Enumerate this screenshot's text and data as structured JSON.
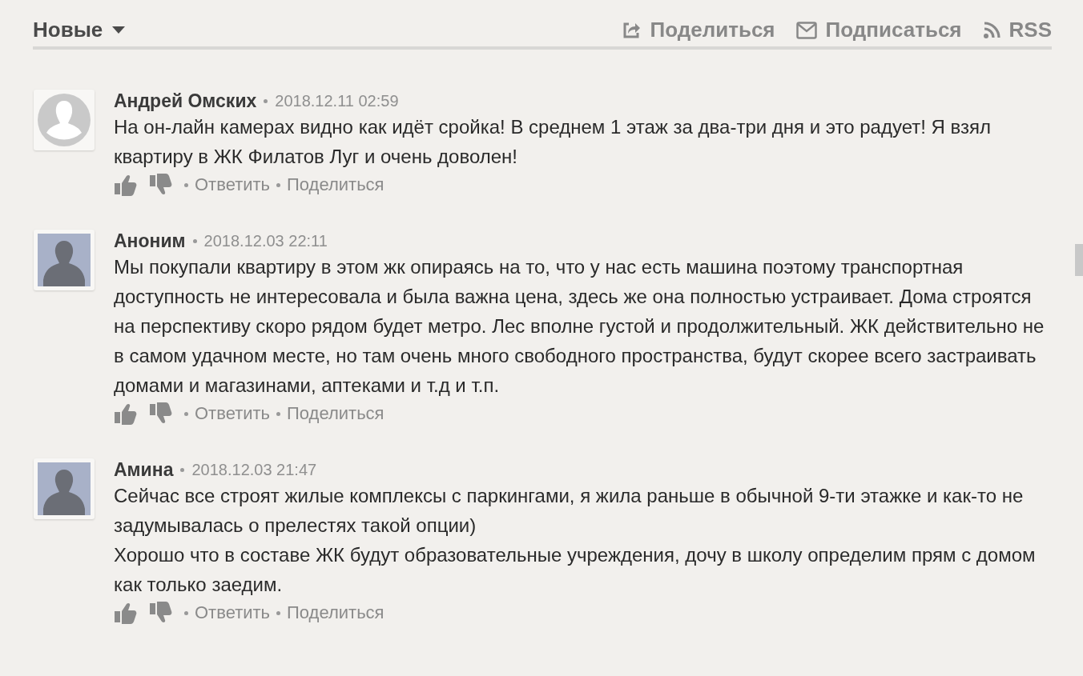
{
  "toolbar": {
    "sort": {
      "label": "Новые"
    },
    "actions": [
      {
        "kind": "share",
        "label": "Поделиться"
      },
      {
        "kind": "subscribe",
        "label": "Подписаться"
      },
      {
        "kind": "rss",
        "label": "RSS"
      }
    ]
  },
  "comments": [
    {
      "author": "Андрей Омских",
      "avatar": {
        "kind": "round"
      },
      "date": "2018.12.11 02:59",
      "paragraphs": [
        "На он-лайн камерах видно как идёт сройка! В среднем 1 этаж за два-три дня и это радует! Я взял квартиру в ЖК Филатов Луг и очень доволен!"
      ],
      "reply": "Ответить",
      "share": "Поделиться"
    },
    {
      "author": "Аноним",
      "avatar": {
        "kind": "square"
      },
      "date": "2018.12.03 22:11",
      "paragraphs": [
        "Мы покупали квартиру в этом жк опираясь на то, что у нас есть машина поэтому транспортная доступность не интересовала и была важна цена, здесь же она полностью устраивает. Дома строятся на перспективу скоро рядом будет метро. Лес вполне густой и продолжительный. ЖК действительно не в самом удачном месте, но там очень много свободного пространства, будут скорее всего застраивать домами и магазинами, аптеками и т.д и т.п."
      ],
      "reply": "Ответить",
      "share": "Поделиться"
    },
    {
      "author": "Амина",
      "avatar": {
        "kind": "square"
      },
      "date": "2018.12.03 21:47",
      "paragraphs": [
        "Сейчас все строят жилые комплексы с паркингами, я жила раньше в обычной 9-ти этажке и как-то не задумывалась о прелестях такой опции)",
        "Хорошо что в составе ЖК будут образовательные учреждения, дочу в школу определим прям с домом как только заедим."
      ],
      "reply": "Ответить",
      "share": "Поделиться"
    }
  ]
}
